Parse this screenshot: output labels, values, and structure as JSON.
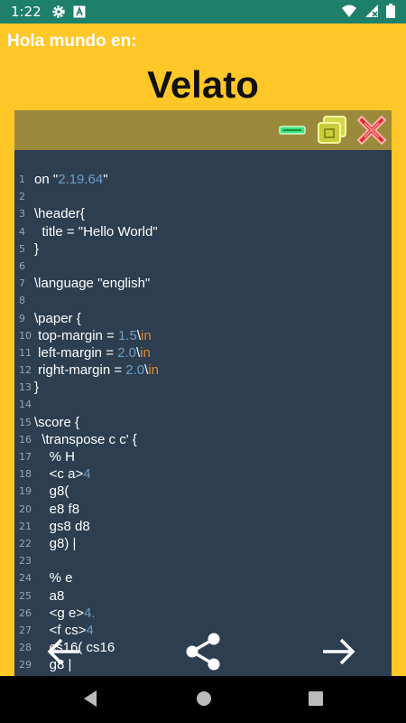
{
  "status_bar": {
    "time": "1:22",
    "icons": [
      "gear-icon",
      "a-box-icon",
      "wifi-icon",
      "no-sim-icon",
      "battery-icon"
    ]
  },
  "header": {
    "hello_label": "Hola mundo en:",
    "language_title": "Velato"
  },
  "toolbar": {
    "buttons": [
      "minimize-button",
      "copy-button",
      "close-button"
    ]
  },
  "code": {
    "lines": [
      [
        {
          "t": "on \""
        },
        {
          "t": "2.19.64",
          "c": "num"
        },
        {
          "t": "\""
        }
      ],
      [],
      [
        {
          "t": "\\header{"
        }
      ],
      [
        {
          "t": "  title = \"Hello World\""
        }
      ],
      [
        {
          "t": "}"
        }
      ],
      [],
      [
        {
          "t": "\\language \"english\""
        }
      ],
      [],
      [
        {
          "t": "\\paper {"
        }
      ],
      [
        {
          "t": " top-margin = "
        },
        {
          "t": "1.5",
          "c": "num"
        },
        {
          "t": "\\"
        },
        {
          "t": "in",
          "c": "unit"
        }
      ],
      [
        {
          "t": " left-margin = "
        },
        {
          "t": "2.0",
          "c": "num"
        },
        {
          "t": "\\"
        },
        {
          "t": "in",
          "c": "unit"
        }
      ],
      [
        {
          "t": " right-margin = "
        },
        {
          "t": "2.0",
          "c": "num"
        },
        {
          "t": "\\"
        },
        {
          "t": "in",
          "c": "unit"
        }
      ],
      [
        {
          "t": "}"
        }
      ],
      [],
      [
        {
          "t": "\\score {"
        }
      ],
      [
        {
          "t": "  \\transpose c c' {"
        }
      ],
      [
        {
          "t": "    % H"
        }
      ],
      [
        {
          "t": "    <c a>"
        },
        {
          "t": "4",
          "c": "num"
        }
      ],
      [
        {
          "t": "    g8("
        }
      ],
      [
        {
          "t": "    e8 f8"
        }
      ],
      [
        {
          "t": "    gs8 d8"
        }
      ],
      [
        {
          "t": "    g8) |"
        }
      ],
      [],
      [
        {
          "t": "    % e"
        }
      ],
      [
        {
          "t": "    a8"
        }
      ],
      [
        {
          "t": "    <g e>"
        },
        {
          "t": "4.",
          "c": "num"
        }
      ],
      [
        {
          "t": "    <f cs>"
        },
        {
          "t": "4",
          "c": "num"
        }
      ],
      [
        {
          "t": "    cs16( cs16"
        }
      ],
      [
        {
          "t": "    g8 |"
        }
      ]
    ]
  },
  "bottom_actions": [
    "back-arrow",
    "share",
    "forward-arrow"
  ],
  "nav": [
    "back",
    "home",
    "recents"
  ]
}
